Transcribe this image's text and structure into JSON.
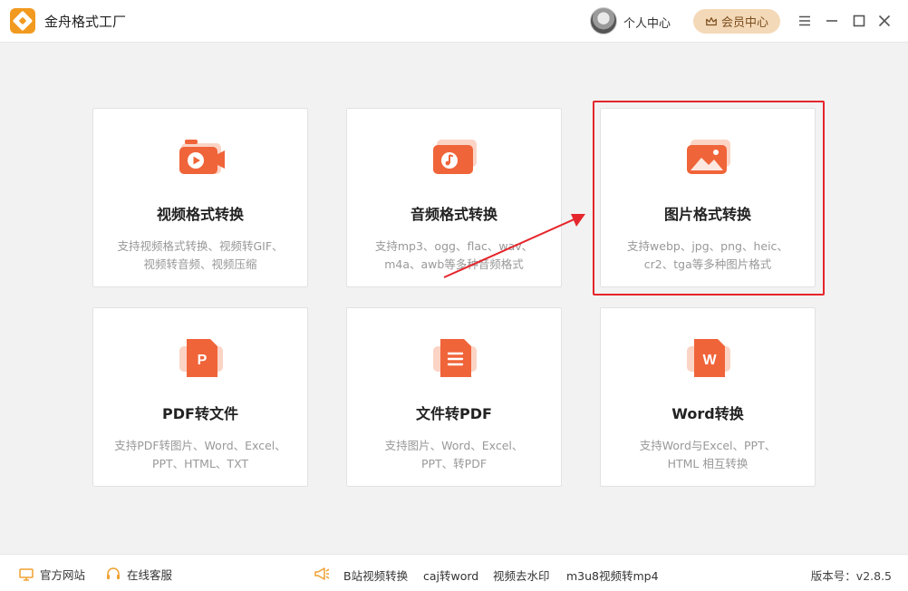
{
  "window": {
    "title": "金舟格式工厂",
    "user_center_label": "个人中心",
    "vip_label": "会员中心",
    "icons": [
      "app-logo-icon",
      "avatar",
      "crown-icon",
      "menu-icon",
      "minimize-icon",
      "maximize-icon",
      "close-icon"
    ]
  },
  "cards": [
    {
      "title": "视频格式转换",
      "desc_line1": "支持视频格式转换、视频转GIF、",
      "desc_line2": "视频转音频、视频压缩",
      "icon": "video-icon"
    },
    {
      "title": "音频格式转换",
      "desc_line1": "支持mp3、ogg、flac、wav、",
      "desc_line2": "m4a、awb等多种音频格式",
      "icon": "audio-icon"
    },
    {
      "title": "图片格式转换",
      "desc_line1": "支持webp、jpg、png、heic、",
      "desc_line2": "cr2、tga等多种图片格式",
      "icon": "image-icon"
    },
    {
      "title": "PDF转文件",
      "desc_line1": "支持PDF转图片、Word、Excel、",
      "desc_line2": "PPT、HTML、TXT",
      "icon": "pdf-icon",
      "glyph": "P"
    },
    {
      "title": "文件转PDF",
      "desc_line1": "支持图片、Word、Excel、",
      "desc_line2": "PPT、转PDF",
      "icon": "document-icon"
    },
    {
      "title": "Word转换",
      "desc_line1": "支持Word与Excel、PPT、",
      "desc_line2": "HTML 相互转换",
      "icon": "word-icon",
      "glyph": "W"
    }
  ],
  "footer": {
    "website": "官方网站",
    "service": "在线客服",
    "links": [
      "B站视频转换",
      "caj转word",
      "视频去水印",
      "m3u8视频转mp4"
    ],
    "version": "版本号：v2.8.5"
  },
  "colors": {
    "accent_orange": "#f0643a",
    "highlight_red": "#e5262c",
    "vip_bg": "#f4d9b8"
  }
}
